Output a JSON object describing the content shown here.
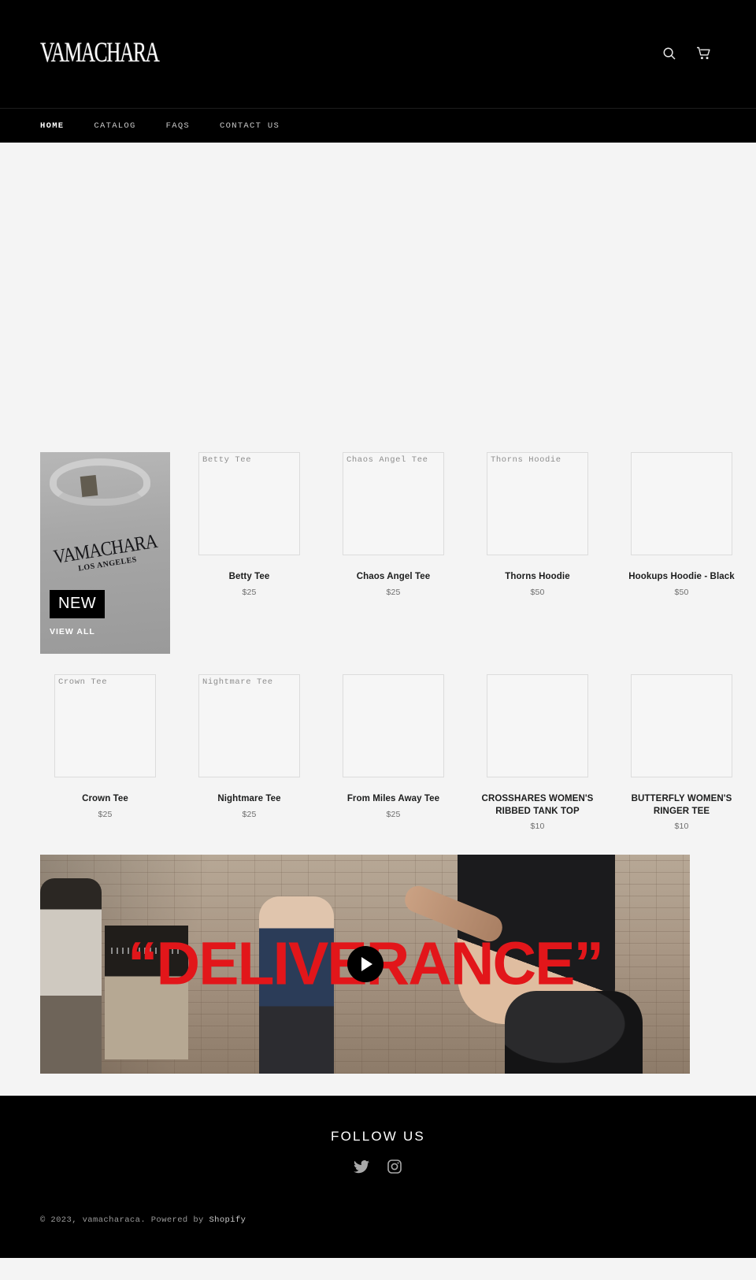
{
  "site": {
    "logo_text": "VAMACHARA"
  },
  "header": {
    "search_icon": "search-icon",
    "cart_icon": "cart-icon"
  },
  "nav": {
    "items": [
      {
        "label": "HOME",
        "active": true
      },
      {
        "label": "CATALOG",
        "active": false
      },
      {
        "label": "FAQS",
        "active": false
      },
      {
        "label": "CONTACT US",
        "active": false
      }
    ]
  },
  "featured": {
    "badge": "NEW",
    "view_all": "VIEW ALL",
    "print_line1": "VAMACHARA",
    "print_line2": "LOS ANGELES"
  },
  "products": {
    "row1": [
      {
        "alt": "Betty Tee",
        "title": "Betty Tee",
        "price": "$25"
      },
      {
        "alt": "Chaos Angel Tee",
        "title": "Chaos Angel Tee",
        "price": "$25"
      },
      {
        "alt": "Thorns Hoodie",
        "title": "Thorns Hoodie",
        "price": "$50"
      },
      {
        "alt": "",
        "title": "Hookups Hoodie - Black",
        "price": "$50"
      }
    ],
    "row2": [
      {
        "alt": "Crown Tee",
        "title": "Crown Tee",
        "price": "$25"
      },
      {
        "alt": "Nightmare Tee",
        "title": "Nightmare Tee",
        "price": "$25"
      },
      {
        "alt": "",
        "title": "From Miles Away Tee",
        "price": "$25"
      },
      {
        "alt": "",
        "title": "CROSSHARES WOMEN'S RIBBED TANK TOP",
        "price": "$10"
      },
      {
        "alt": "",
        "title": "BUTTERFLY WOMEN'S RINGER TEE",
        "price": "$10"
      }
    ]
  },
  "video": {
    "title": "“DELIVERANCE”",
    "play_label": "play-button",
    "title_color": "#e2161a"
  },
  "footer": {
    "follow_heading": "FOLLOW US",
    "social": [
      {
        "name": "twitter-icon"
      },
      {
        "name": "instagram-icon"
      }
    ],
    "copyright_prefix": "© 2023, vamacharaca. Powered by ",
    "copyright_link": "Shopify"
  },
  "colors": {
    "header_bg": "#000000",
    "page_bg": "#f4f4f4",
    "accent_red": "#e2161a"
  }
}
